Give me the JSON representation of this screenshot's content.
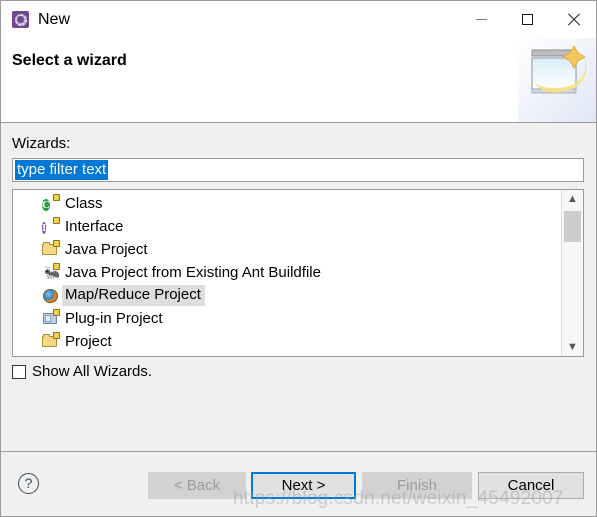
{
  "window": {
    "title": "New",
    "icon": "eclipse-new-icon",
    "controls": {
      "minimize": "minimize-icon",
      "maximize": "maximize-icon",
      "close": "close-icon"
    }
  },
  "header": {
    "title": "Select a wizard",
    "banner_icon": "wizard-banner-icon"
  },
  "body": {
    "wizards_label": "Wizards:",
    "filter": {
      "value": "type filter text",
      "placeholder": "type filter text",
      "selected": true,
      "selection_color": "#0078d7"
    },
    "tree": {
      "items": [
        {
          "label": "Class",
          "icon": "java-class-icon",
          "selected": false
        },
        {
          "label": "Interface",
          "icon": "java-interface-icon",
          "selected": false
        },
        {
          "label": "Java Project",
          "icon": "java-project-icon",
          "selected": false
        },
        {
          "label": "Java Project from Existing Ant Buildfile",
          "icon": "ant-buildfile-icon",
          "selected": false
        },
        {
          "label": "Map/Reduce Project",
          "icon": "map-reduce-icon",
          "selected": true
        },
        {
          "label": "Plug-in Project",
          "icon": "plugin-project-icon",
          "selected": false
        },
        {
          "label": "Project",
          "icon": "project-icon",
          "selected": false
        }
      ],
      "selected_item": "Map/Reduce Project",
      "selection_color": "#dedede",
      "scrollbar": {
        "up_arrow": "chevron-up-icon",
        "down_arrow": "chevron-down-icon",
        "thumb_position_percent": 13
      }
    },
    "show_all_wizards": {
      "label": "Show All Wizards.",
      "checked": false
    }
  },
  "footer": {
    "help_icon": "help-icon",
    "buttons": [
      {
        "id": "back",
        "label": "< Back",
        "enabled": false,
        "default": false
      },
      {
        "id": "next",
        "label": "Next >",
        "enabled": true,
        "default": true
      },
      {
        "id": "finish",
        "label": "Finish",
        "enabled": false,
        "default": false
      },
      {
        "id": "cancel",
        "label": "Cancel",
        "enabled": true,
        "default": false
      }
    ]
  },
  "watermark": {
    "text": "https://blog.csdn.net/weixin_45492007"
  }
}
